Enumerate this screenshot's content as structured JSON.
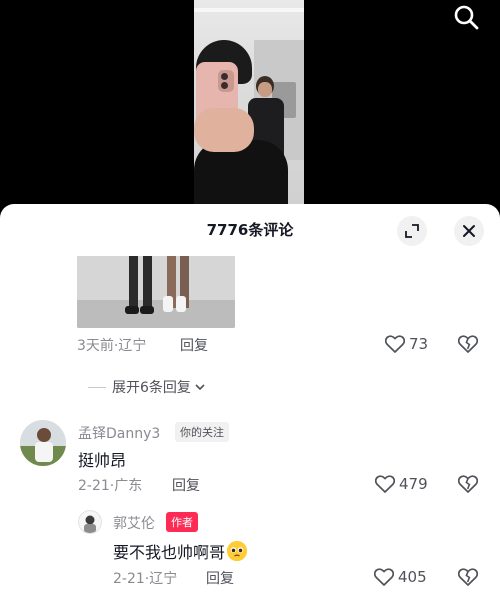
{
  "panel": {
    "title": "7776条评论",
    "expand_icon": "expand-corner-icon",
    "close_icon": "close-icon"
  },
  "top_bar": {
    "search_icon": "search-icon"
  },
  "comment1": {
    "time_location": "3天前·辽宁",
    "reply_label": "回复",
    "likes": "73"
  },
  "expand_replies": {
    "label": "展开6条回复"
  },
  "comment2": {
    "username": "孟铎Danny3",
    "follow_badge": "你的关注",
    "text": "挺帅昂",
    "time_location": "2-21·广东",
    "reply_label": "回复",
    "likes": "479"
  },
  "reply1": {
    "username": "郭艾伦",
    "author_badge": "作者",
    "text": "要不我也帅啊哥",
    "emoji": "pleading-face-emoji",
    "time_location": "2-21·辽宁",
    "reply_label": "回复",
    "likes": "405"
  },
  "colors": {
    "accent": "#fe2c55",
    "text": "#161823",
    "meta": "#8a8b91",
    "panel": "#ffffff"
  }
}
